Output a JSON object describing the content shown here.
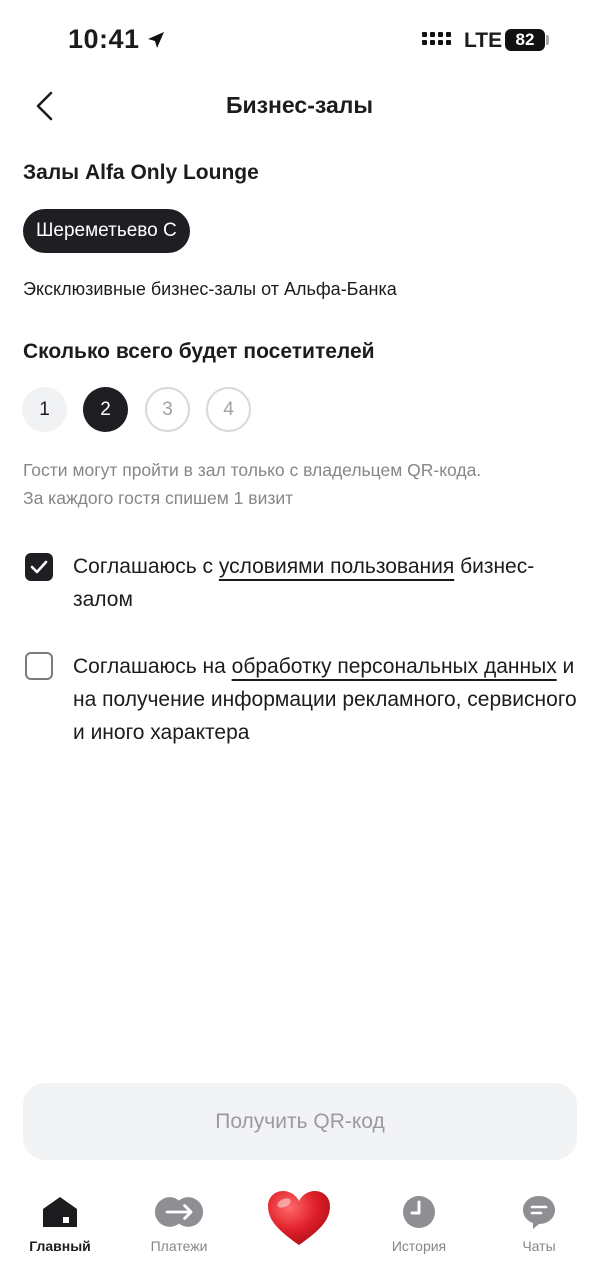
{
  "status_bar": {
    "time": "10:41",
    "network": "LTE",
    "battery": "82"
  },
  "header": {
    "title": "Бизнес-залы",
    "back_icon": "chevron-left-icon"
  },
  "lounges": {
    "title": "Залы Alfa Only Lounge",
    "selected_chip": "Шереметьево С",
    "description": "Эксклюзивные бизнес-залы от Альфа-Банка"
  },
  "visitors": {
    "title": "Сколько всего будет посетителей",
    "options": [
      "1",
      "2",
      "3",
      "4"
    ],
    "selected": "2",
    "hint_line1": "Гости могут пройти в зал только с владельцем QR-кода.",
    "hint_line2": "За каждого гостя спишем 1 визит"
  },
  "agreements": {
    "terms": {
      "checked": true,
      "prefix": "Соглашаюсь с ",
      "link": "условиями пользования",
      "suffix": " бизнес-залом"
    },
    "personal_data": {
      "checked": false,
      "prefix": "Соглашаюсь на ",
      "link": "обработку персональных данных",
      "suffix": " и на получение информации рекламного, сервисного и иного характера"
    }
  },
  "action": {
    "qr_button": "Получить QR-код"
  },
  "tab_bar": {
    "items": [
      {
        "label": "Главный",
        "icon": "home-icon",
        "active": true
      },
      {
        "label": "Платежи",
        "icon": "transfer-icon",
        "active": false
      },
      {
        "label": "",
        "icon": "heart-icon",
        "active": false
      },
      {
        "label": "История",
        "icon": "clock-icon",
        "active": false
      },
      {
        "label": "Чаты",
        "icon": "chat-icon",
        "active": false
      }
    ]
  },
  "colors": {
    "dark": "#1f1f23",
    "muted": "#86868b",
    "button_bg": "#f2f3f5",
    "heart": "#e0202a"
  }
}
